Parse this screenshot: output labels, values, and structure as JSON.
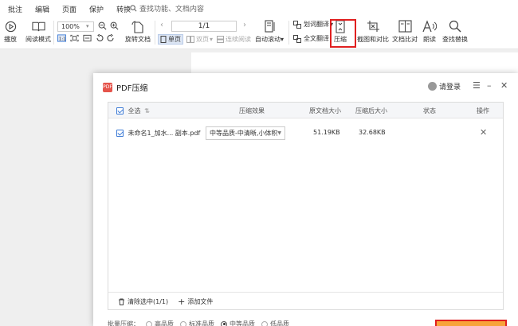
{
  "menubar": {
    "items": [
      "批注",
      "编辑",
      "页面",
      "保护",
      "转换"
    ],
    "search_placeholder": "查找功能、文档内容"
  },
  "toolbar": {
    "play": "播放",
    "read_mode": "阅读模式",
    "zoom": "100%",
    "rotate": "旋转文档",
    "page_indicator": "1/1",
    "single_page": "单页",
    "double_page": "双页",
    "continuous": "连续阅读",
    "auto_scroll": "自动滚动",
    "translate_word": "划词翻译",
    "translate_full": "全文翻译",
    "compress": "压缩",
    "screenshot_compare": "截图和对比",
    "doc_compare": "文档比对",
    "read_aloud": "朗读",
    "find_replace": "查找替换"
  },
  "dialog": {
    "logo": "PDF",
    "title": "PDF压缩",
    "login": "请登录",
    "columns": {
      "select_all": "全选",
      "effect": "压缩效果",
      "original_size": "原文档大小",
      "compressed_size": "压缩后大小",
      "status": "状态",
      "action": "操作"
    },
    "rows": [
      {
        "filename": "未命名1_加水... 副本.pdf",
        "effect": "中等品质-中清晰,小体积",
        "original_size": "51.19KB",
        "compressed_size": "32.68KB",
        "status": ""
      }
    ],
    "footer": {
      "clear_selected": "清除选中(1/1)",
      "add_file": "添加文件"
    },
    "batch_label": "批量压缩：",
    "quality_options": [
      "高品质",
      "标准品质",
      "中等品质",
      "低品质"
    ],
    "selected_quality": "中等品质"
  },
  "colors": {
    "highlight": "#e02020",
    "accent": "#3d7bd6",
    "start_button": "#f7a33a"
  }
}
